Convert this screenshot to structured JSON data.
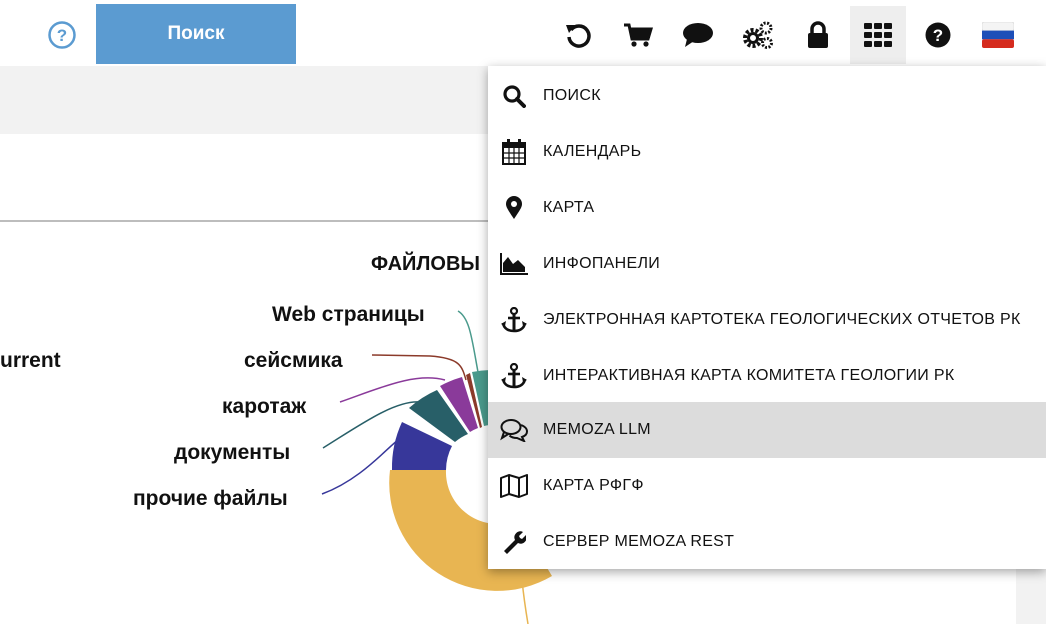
{
  "header": {
    "search_button": "Поиск"
  },
  "toolbar": {
    "icons": [
      "refresh-icon",
      "cart-icon",
      "chat-icon",
      "settings-icon",
      "lock-icon",
      "apps-grid-icon",
      "help-icon",
      "russian-flag-icon"
    ],
    "accent": "#5b9bd1"
  },
  "chart": {
    "title": "ФАЙЛОВЫ",
    "labels": {
      "current": "urrent",
      "web": "Web страницы",
      "seismic": "сейсмика",
      "logging": "каротаж",
      "documents": "документы",
      "other": "прочие файлы"
    }
  },
  "menu": {
    "items": [
      {
        "label": "ПОИСК",
        "icon": "search-icon"
      },
      {
        "label": "КАЛЕНДАРЬ",
        "icon": "calendar-icon"
      },
      {
        "label": "КАРТА",
        "icon": "map-marker-icon"
      },
      {
        "label": "ИНФОПАНЕЛИ",
        "icon": "area-chart-icon"
      },
      {
        "label": "ЭЛЕКТРОННАЯ КАРТОТЕКА ГЕОЛОГИЧЕСКИХ ОТЧЕТОВ РК",
        "icon": "anchor-icon"
      },
      {
        "label": "ИНТЕРАКТИВНАЯ КАРТА КОМИТЕТА ГЕОЛОГИИ РК",
        "icon": "anchor-icon"
      },
      {
        "label": "MEMOZA LLM",
        "icon": "comments-icon"
      },
      {
        "label": "КАРТА РФГФ",
        "icon": "folded-map-icon"
      },
      {
        "label": "СЕРВЕР MEMOZA REST",
        "icon": "wrench-icon"
      }
    ],
    "highlighted_index": 6
  },
  "colors": {
    "yellow": "#e8b552",
    "indigo": "#37379a",
    "teal_dark": "#285f68",
    "purple": "#8a3a9a",
    "brown": "#8b3a2a",
    "teal": "#4a9a8c"
  }
}
